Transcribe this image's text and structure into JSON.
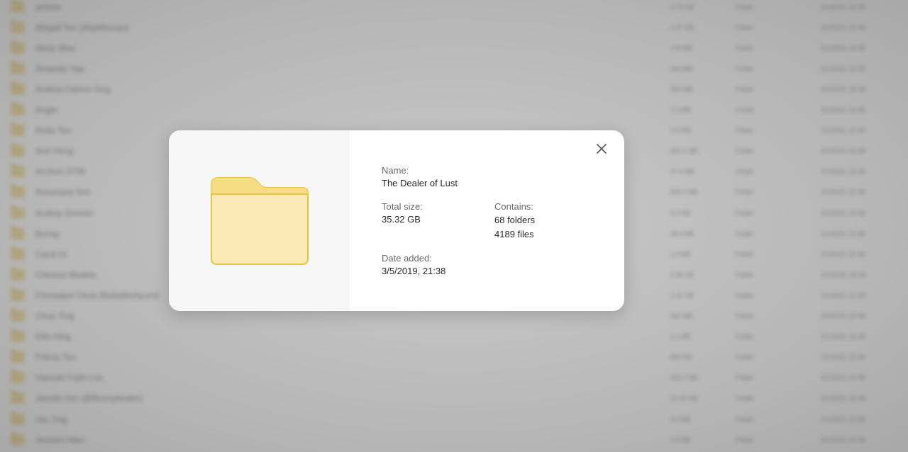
{
  "background_list": {
    "rows": [
      {
        "name": "anhido",
        "size": "3.73 GB",
        "type": "Folder",
        "date": "3/1/2023, 22:38"
      },
      {
        "name": "Abigail Tan (AbyMoreau)",
        "size": "2.47 GB",
        "type": "Folder",
        "date": "3/1/2023, 22:38"
      },
      {
        "name": "Alicia Wee",
        "size": "774 MB",
        "type": "Folder",
        "date": "3/1/2023, 22:38"
      },
      {
        "name": "Amanda Yap",
        "size": "444 MB",
        "type": "Folder",
        "date": "3/1/2023, 22:38"
      },
      {
        "name": "Andrea Clarice Ong",
        "size": "933 MB",
        "type": "Folder",
        "date": "3/1/2023, 22:38"
      },
      {
        "name": "Angie",
        "size": "2.3 MB",
        "type": "Folder",
        "date": "3/1/2023, 22:38"
      },
      {
        "name": "Anita Teo",
        "size": "1.8 MB",
        "type": "Folder",
        "date": "3/1/2023, 22:38"
      },
      {
        "name": "Ann Heng",
        "size": "865.4 MB",
        "type": "Folder",
        "date": "3/1/2023, 22:38"
      },
      {
        "name": "Archive 2738",
        "size": "47.4 MB",
        "type": "Folder",
        "date": "3/1/2023, 22:38"
      },
      {
        "name": "Assumpta Sim",
        "size": "509.4 MB",
        "type": "Folder",
        "date": "3/1/2023, 22:38"
      },
      {
        "name": "Audrey Zimmer",
        "size": "5.4 MB",
        "type": "Folder",
        "date": "3/1/2023, 22:38"
      },
      {
        "name": "Bunay",
        "size": "36.4 MB",
        "type": "Folder",
        "date": "3/1/2023, 22:38"
      },
      {
        "name": "Carol Oi",
        "size": "2.2 MB",
        "type": "Folder",
        "date": "3/1/2023, 22:38"
      },
      {
        "name": "Chinese Models",
        "size": "2.38 GB",
        "type": "Folder",
        "date": "3/1/2023, 22:38"
      },
      {
        "name": "Christabel Chua (BellaWeAyumi)",
        "size": "1.41 GB",
        "type": "Folder",
        "date": "3/1/2023, 22:38"
      },
      {
        "name": "Chue Ting",
        "size": "930 MB",
        "type": "Folder",
        "date": "3/1/2023, 22:38"
      },
      {
        "name": "Ellis Hing",
        "size": "1.1 MB",
        "type": "Folder",
        "date": "3/1/2023, 22:38"
      },
      {
        "name": "Felicia Teo",
        "size": "809 KB",
        "type": "Folder",
        "date": "3/1/2023, 22:38"
      },
      {
        "name": "Hannah Faith Lee",
        "size": "493.7 MB",
        "type": "Folder",
        "date": "3/1/2023, 22:38"
      },
      {
        "name": "Janelle Ooi (@Bunnylander)",
        "size": "12.43 GB",
        "type": "Folder",
        "date": "3/1/2023, 22:38"
      },
      {
        "name": "Jas Ong",
        "size": "4.3 MB",
        "type": "Folder",
        "date": "3/1/2023, 22:38"
      },
      {
        "name": "Jessten Wee",
        "size": "5.9 MB",
        "type": "Folder",
        "date": "3/1/2023, 22:38"
      }
    ]
  },
  "dialog": {
    "name_label": "Name:",
    "name_value": "The Dealer of Lust",
    "size_label": "Total size:",
    "size_value": "35.32 GB",
    "contains_label": "Contains:",
    "contains_folders": "68 folders",
    "contains_files": "4189 files",
    "date_label": "Date added:",
    "date_value": "3/5/2019, 21:38",
    "icon": "folder-icon",
    "close_icon": "close-icon"
  },
  "colors": {
    "folder_fill": "#fbeab6",
    "folder_tab": "#f7dc86",
    "folder_stroke": "#e8c43d",
    "preview_bg": "#f7f7f7"
  }
}
